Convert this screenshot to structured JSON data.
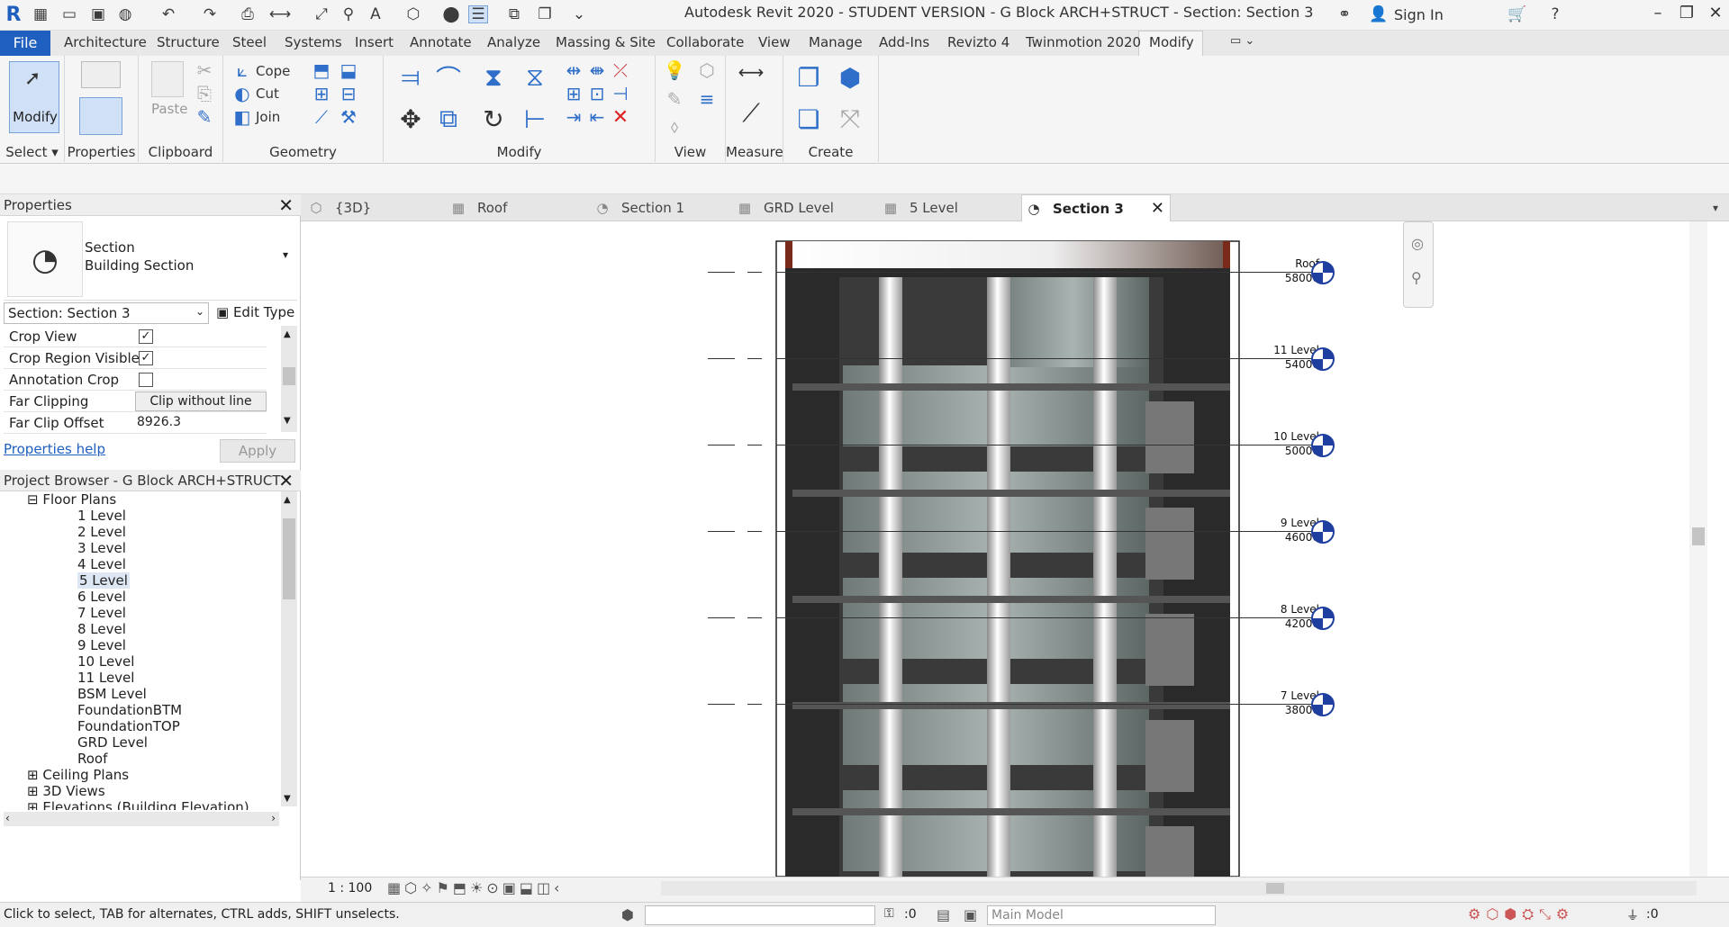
{
  "app": {
    "title": "Autodesk Revit 2020 - STUDENT VERSION - G Block ARCH+STRUCT - Section: Section 3",
    "signin_label": "Sign In"
  },
  "menu": {
    "file": "File",
    "items": [
      "Architecture",
      "Structure",
      "Steel",
      "Systems",
      "Insert",
      "Annotate",
      "Analyze",
      "Massing & Site",
      "Collaborate",
      "View",
      "Manage",
      "Add-Ins",
      "Revizto 4",
      "Twinmotion 2020",
      "Modify"
    ]
  },
  "ribbon": {
    "modify_label": "Modify",
    "paste_label": "Paste",
    "cope_label": "Cope",
    "cut_label": "Cut",
    "join_label": "Join",
    "groups": {
      "select": "Select",
      "properties": "Properties",
      "clipboard": "Clipboard",
      "geometry": "Geometry",
      "modify": "Modify",
      "view": "View",
      "measure": "Measure",
      "create": "Create"
    }
  },
  "properties": {
    "header": "Properties",
    "type_line1": "Section",
    "type_line2": "Building Section",
    "selector": "Section: Section 3",
    "edit_type": "Edit Type",
    "rows": [
      {
        "key": "Crop View",
        "checked": true
      },
      {
        "key": "Crop Region Visible",
        "checked": true
      },
      {
        "key": "Annotation Crop",
        "checked": false
      },
      {
        "key": "Far Clipping",
        "value": "Clip without line"
      },
      {
        "key": "Far Clip Offset",
        "value": "8926.3"
      }
    ],
    "help": "Properties help",
    "apply": "Apply"
  },
  "browser": {
    "header": "Project Browser - G Block ARCH+STRUCT",
    "floor_plans": "Floor Plans",
    "levels": [
      "1 Level",
      "2 Level",
      "3 Level",
      "4 Level",
      "5 Level",
      "6 Level",
      "7 Level",
      "8 Level",
      "9 Level",
      "10 Level",
      "11 Level",
      "BSM Level",
      "FoundationBTM",
      "FoundationTOP",
      "GRD Level",
      "Roof"
    ],
    "selected": "5 Level",
    "ceiling_plans": "Ceiling Plans",
    "views_3d": "3D Views",
    "elevations": "Elevations (Building Elevation)"
  },
  "tabs": [
    "{3D}",
    "Roof",
    "Section 1",
    "GRD Level",
    "5 Level",
    "Section 3"
  ],
  "active_tab": "Section 3",
  "levels": [
    {
      "name": "Roof",
      "elevation": "58000"
    },
    {
      "name": "11 Level",
      "elevation": "54000"
    },
    {
      "name": "10 Level",
      "elevation": "50000"
    },
    {
      "name": "9 Level",
      "elevation": "46000"
    },
    {
      "name": "8 Level",
      "elevation": "42000"
    },
    {
      "name": "7 Level",
      "elevation": "38000"
    }
  ],
  "viewbar": {
    "scale": "1 : 100"
  },
  "status": {
    "hint": "Click to select, TAB for alternates, CTRL adds, SHIFT unselects.",
    "count": ":0",
    "model": "Main Model",
    "filter": ":0"
  },
  "colors": {
    "accent": "#1f5fbf",
    "level_marker": "#1f3fa0"
  }
}
